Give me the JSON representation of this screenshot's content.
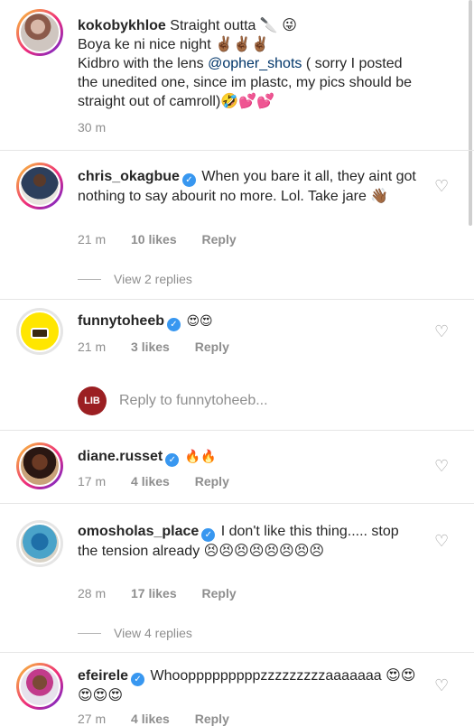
{
  "caption": {
    "username": "kokobykhloe",
    "lines": [
      "Straight outta 🔪 😜",
      "Boya ke ni nice night ✌🏾✌🏾✌🏾",
      "Kidbro with the lens ",
      "( sorry I posted the unedited one, since im plastc, my pics should be straight out of camroll)🤣💕💕"
    ],
    "mention": "@opher_shots",
    "time": "30 m"
  },
  "comments": [
    {
      "username": "chris_okagbue",
      "text": "When you bare it all, they aint got nothing to say abourit no more. Lol. Take jare 👋🏾",
      "time": "21 m",
      "likes": "10 likes",
      "reply": "Reply",
      "view_replies": "View 2 replies"
    },
    {
      "username": "funnytoheeb",
      "text": "😍😍",
      "time": "21 m",
      "likes": "3 likes",
      "reply": "Reply"
    },
    {
      "username": "diane.russet",
      "text": "🔥🔥",
      "time": "17 m",
      "likes": "4 likes",
      "reply": "Reply"
    },
    {
      "username": "omosholas_place",
      "text": "I don't like this thing..... stop the tension already 😣😣😣😣😣😣😣😣",
      "time": "28 m",
      "likes": "17 likes",
      "reply": "Reply",
      "view_replies": "View 4 replies"
    },
    {
      "username": "efeirele",
      "text": "Whoopppppppppzzzzzzzzzaaaaaaa 😍😍😍😍😍",
      "time": "27 m",
      "likes": "4 likes",
      "reply": "Reply"
    }
  ],
  "reply_bar": {
    "badge": "LIB",
    "placeholder": "Reply to funnytoheeb..."
  },
  "icons": {
    "heart": "heart-outline-icon",
    "verified": "verified-badge-icon"
  },
  "colors": {
    "verified": "#3897f0",
    "mention": "#003569",
    "secondary_text": "#8e8e8e",
    "badge": "#9b1f22"
  }
}
